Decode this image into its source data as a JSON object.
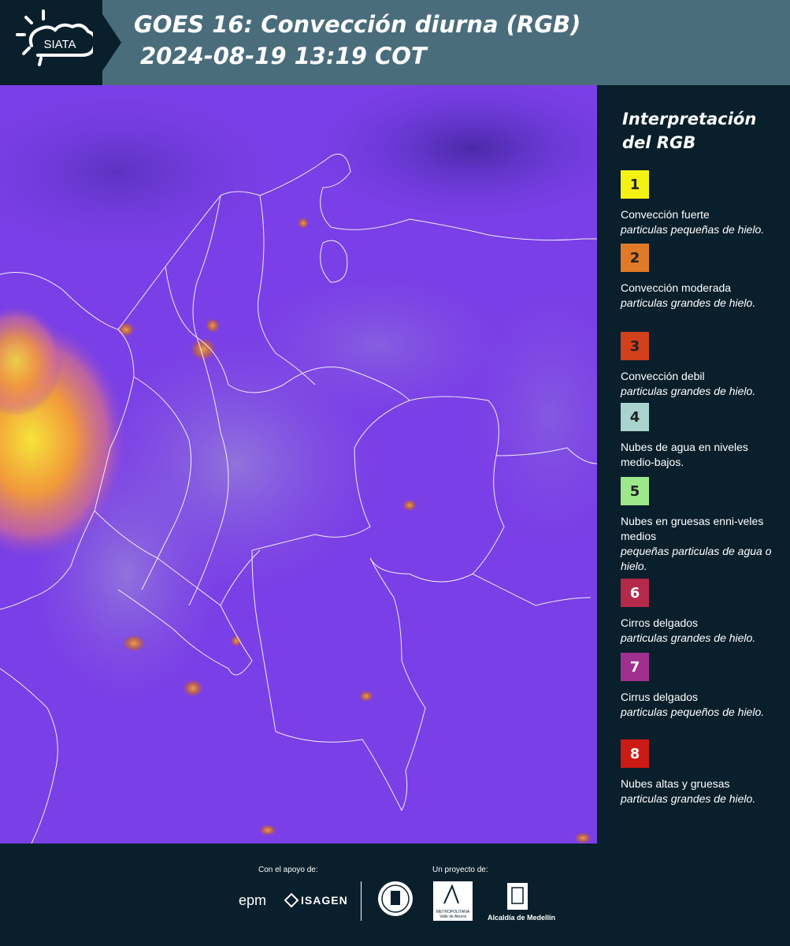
{
  "header": {
    "logo_text": "SIATA",
    "title_line1": "GOES 16: Convección diurna (RGB)",
    "title_line2": "2024-08-19 13:19 COT"
  },
  "legend": {
    "title_line1": "Interpretación",
    "title_line2": "del RGB",
    "items": [
      {
        "num": "1",
        "color": "#f4f213",
        "label": "Convección fuerte",
        "sub": "particulas pequeñas de hielo."
      },
      {
        "num": "2",
        "color": "#e07a28",
        "label": "Convección moderada",
        "sub": "particulas grandes de hielo."
      },
      {
        "num": "3",
        "color": "#d2401c",
        "label": "Convección debil",
        "sub": "particulas grandes de hielo."
      },
      {
        "num": "4",
        "color": "#a8d3cf",
        "label": "Nubes de agua en niveles medio-bajos.",
        "sub": ""
      },
      {
        "num": "5",
        "color": "#9de88a",
        "label": "Nubes en gruesas enni-veles medios",
        "sub": "pequeñas particulas de agua o hielo."
      },
      {
        "num": "6",
        "color": "#b5294a",
        "label": "Cirros delgados",
        "sub": "particulas grandes de hielo."
      },
      {
        "num": "7",
        "color": "#a0308f",
        "label": "Cirrus delgados",
        "sub": "particulas pequeños de hielo."
      },
      {
        "num": "8",
        "color": "#cc1a14",
        "label": "Nubes altas y gruesas",
        "sub": "particulas grandes de hielo."
      }
    ]
  },
  "footer": {
    "support_label": "Con el apoyo de:",
    "project_label": "Un proyecto de:",
    "epm_text": "epm",
    "isagen_text": "ISAGEN",
    "metro_text": "METROPOLITANA",
    "metro_sub": "Valle de Aburrá",
    "alcaldia_text": "Alcaldía de Medellín"
  },
  "colors": {
    "header_bg": "#4a6d7c",
    "dark_bg": "#0a1f2c",
    "map_base": "#7a3fe6"
  }
}
